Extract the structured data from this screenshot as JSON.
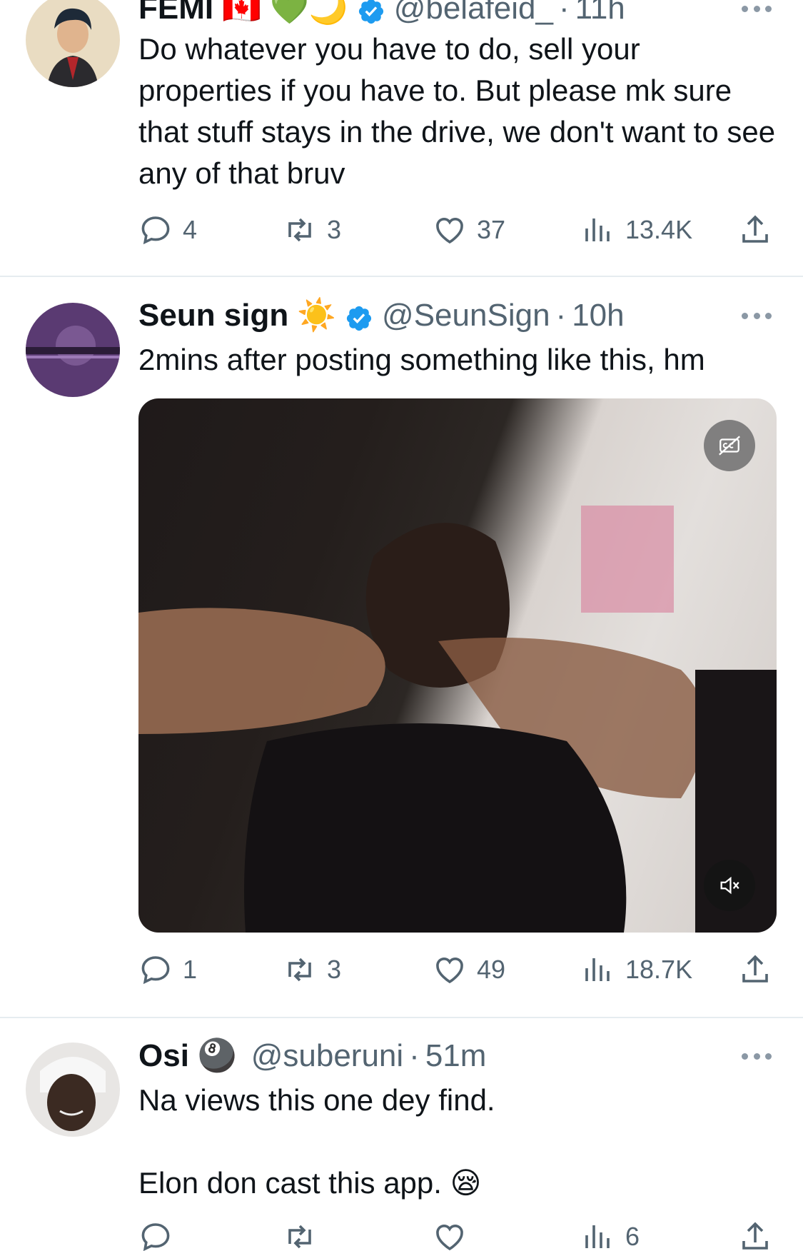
{
  "tweets": [
    {
      "name": "FEMI",
      "emojis": "🇨🇦 💚🌙",
      "handle": "@belafeid_",
      "time": "11h",
      "text": "Do whatever you have to do, sell your properties if you have to. But please mk sure that stuff stays in the drive, we don't want to see any of that bruv",
      "replies": "4",
      "retweets": "3",
      "likes": "37",
      "views": "13.4K"
    },
    {
      "name": "Seun sign",
      "emojis": "☀️",
      "handle": "@SeunSign",
      "time": "10h",
      "text": "2mins after posting something like this, hm",
      "replies": "1",
      "retweets": "3",
      "likes": "49",
      "views": "18.7K",
      "media": {
        "type": "video",
        "cc_icon": "cc-icon",
        "mute_icon": "muted-speaker-icon"
      }
    },
    {
      "name": "Osi",
      "emojis": "🎱",
      "handle": "@suberuni",
      "time": "51m",
      "text_line1": "Na views this one dey find.",
      "text_line2": "Elon don cast this app. 😪",
      "replies": "",
      "retweets": "",
      "likes": "",
      "views": "6"
    }
  ],
  "separator": "·",
  "colors": {
    "text": "#0f1419",
    "secondary": "#536471",
    "verified": "#1d9bf0",
    "divider": "#e6ecf0"
  }
}
